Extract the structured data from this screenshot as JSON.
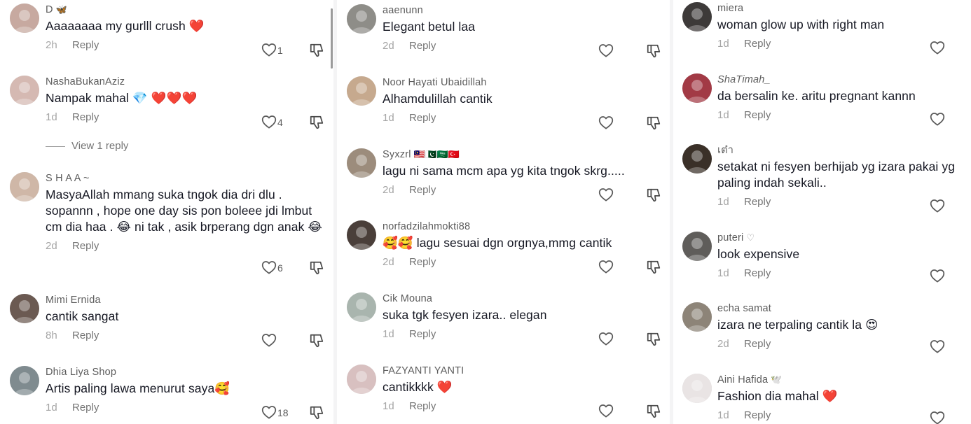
{
  "columns": [
    {
      "comments": [
        {
          "username": "D",
          "tag": "🦋",
          "text": "Aaaaaaaa my gurlll crush ❤️",
          "time": "2h",
          "reply": "Reply",
          "likes": "1",
          "avatar": "#c7a9a0"
        },
        {
          "username": "NashaBukanAziz",
          "text": "Nampak mahal 💎 ❤️❤️❤️",
          "time": "1d",
          "reply": "Reply",
          "likes": "4",
          "avatar": "#d5b9b2",
          "view_replies": "View 1 reply"
        },
        {
          "username": "S H A A ~",
          "text": "MasyaAllah mmang suka tngok dia dri dlu . sopannn , hope one day sis pon boleee jdi lmbut cm dia haa . 😂 ni tak , asik brperang dgn anak 😂",
          "time": "2d",
          "reply": "Reply",
          "likes": "6",
          "avatar": "#cfb7a7"
        },
        {
          "username": "Mimi Ernida",
          "text": "cantik sangat",
          "time": "8h",
          "reply": "Reply",
          "likes": "",
          "avatar": "#6b5a52"
        },
        {
          "username": "Dhia Liya Shop",
          "text": "Artis paling lawa menurut saya🥰",
          "time": "1d",
          "reply": "Reply",
          "likes": "18",
          "avatar": "#7f8b8f"
        }
      ]
    },
    {
      "comments": [
        {
          "username": "aaenunn",
          "text": "Elegant betul laa",
          "time": "2d",
          "reply": "Reply",
          "likes": "",
          "avatar": "#8e8d88"
        },
        {
          "username": "Noor Hayati Ubaidillah",
          "text": "Alhamdulillah cantik",
          "time": "1d",
          "reply": "Reply",
          "likes": "",
          "avatar": "#c6a98e"
        },
        {
          "username": "Syxzrl",
          "tag": "🇲🇾🇵🇰🇸🇦🇹🇷",
          "text": "lagu ni sama mcm apa yg kita tngok skrg.....",
          "time": "2d",
          "reply": "Reply",
          "likes": "",
          "avatar": "#9c8c7c"
        },
        {
          "username": "norfadzilahmokti88",
          "text": "🥰🥰 lagu sesuai dgn orgnya,mmg cantik",
          "time": "2d",
          "reply": "Reply",
          "likes": "",
          "avatar": "#4a3f3a"
        },
        {
          "username": "Cik Mouna",
          "text": "suka tgk fesyen izara.. elegan",
          "time": "1d",
          "reply": "Reply",
          "likes": "",
          "avatar": "#a9b5ae"
        },
        {
          "username": "FAZYANTI  YANTI",
          "text": "cantikkkk ❤️",
          "time": "1d",
          "reply": "Reply",
          "likes": "",
          "avatar": "#d8c0c0"
        }
      ]
    },
    {
      "comments": [
        {
          "username": "miera",
          "text": "woman glow up with right man",
          "time": "1d",
          "reply": "Reply",
          "avatar": "#3d3a39"
        },
        {
          "username": "ShaTimah_",
          "text": "da bersalin ke. aritu pregnant kannn",
          "time": "1d",
          "reply": "Reply",
          "avatar": "#a23a45"
        },
        {
          "username": "เต๋า",
          "text": "setakat ni fesyen berhijab yg izara pakai yg paling indah sekali..",
          "time": "1d",
          "reply": "Reply",
          "avatar": "#3a3028"
        },
        {
          "username": "puteri",
          "tag": "♡",
          "text": "look expensive",
          "time": "1d",
          "reply": "Reply",
          "avatar": "#5f5d5a"
        },
        {
          "username": "echa samat",
          "text": "izara ne terpaling cantik la 😍",
          "time": "2d",
          "reply": "Reply",
          "avatar": "#8d8478"
        },
        {
          "username": "Aini Hafida",
          "tag": "🕊️",
          "text": "Fashion dia mahal ❤️",
          "time": "1d",
          "reply": "Reply",
          "avatar": "#e9e4e4"
        }
      ]
    }
  ]
}
